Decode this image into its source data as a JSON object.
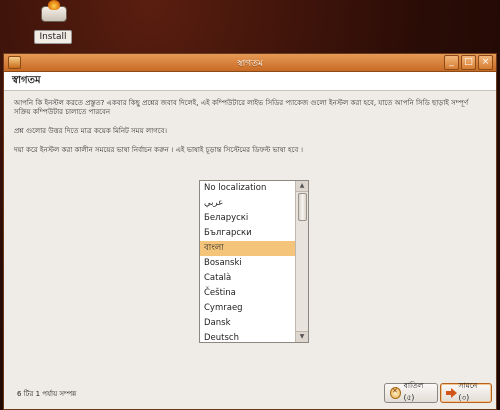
{
  "desktop": {
    "icon_label": "Install",
    "icon_name": "ubuntu-installer-icon"
  },
  "window": {
    "title": "স্বাগতম",
    "controls": {
      "minimize": "_",
      "maximize": "□",
      "close": "×"
    }
  },
  "header": {
    "heading": "স্বাগতম"
  },
  "content": {
    "paragraph1": "আপনি কি ইনস্টল করতে প্রস্তুত? একবার কিছু প্রশ্নের জবাব দিলেই, এই কম্পিউটারে লাইভ সিডির প্যাকেজ গুলো ইনস্টল করা হবে, যাতে আপনি সিডি ছাড়াই সম্পূর্ণ সক্রিয় কম্পিউটার চালাতে পারবেন",
    "paragraph2": "প্রশ্ন গুলোর উত্তর দিতে মাত্র কয়েক মিনিট সময় লাগবে।",
    "paragraph3": "দয়া করে ইনস্টল করা কালীন সময়ের ভাষা নির্বাচন করুন । এই ভাষাই চূড়ান্ত সিস্টেমের ডিফল্ট ভাষা হবে ।"
  },
  "languages": {
    "items": [
      "No localization",
      "عربي",
      "Беларускі",
      "Български",
      "বাংলা",
      "Bosanski",
      "Català",
      "Čeština",
      "Cymraeg",
      "Dansk",
      "Deutsch"
    ],
    "selected": "বাংলা"
  },
  "footer": {
    "progress": "6 টির 1 পর্যায় সম্পন্ন",
    "cancel_label": "বাতিল (৫)",
    "forward_label": "সামনে (৩)"
  },
  "colors": {
    "accent": "#e08a3c",
    "selection": "#f3c47a",
    "desktop_bg": "#2a0c06"
  }
}
